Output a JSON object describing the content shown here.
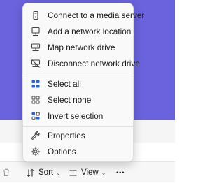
{
  "menu": {
    "items": [
      {
        "label": "Connect to a media server",
        "icon": "media-server-icon"
      },
      {
        "label": "Add a network location",
        "icon": "network-location-icon"
      },
      {
        "label": "Map network drive",
        "icon": "map-drive-icon"
      },
      {
        "label": "Disconnect network drive",
        "icon": "disconnect-drive-icon"
      },
      {
        "label": "Select all",
        "icon": "select-all-icon"
      },
      {
        "label": "Select none",
        "icon": "select-none-icon"
      },
      {
        "label": "Invert selection",
        "icon": "invert-selection-icon"
      },
      {
        "label": "Properties",
        "icon": "properties-icon"
      },
      {
        "label": "Options",
        "icon": "options-icon"
      }
    ]
  },
  "toolbar": {
    "sort_label": "Sort",
    "view_label": "View",
    "more_label": "•••"
  },
  "colors": {
    "background_accent": "#6a63dd",
    "icon_blue": "#2b63c9",
    "icon_dark": "#444444"
  }
}
